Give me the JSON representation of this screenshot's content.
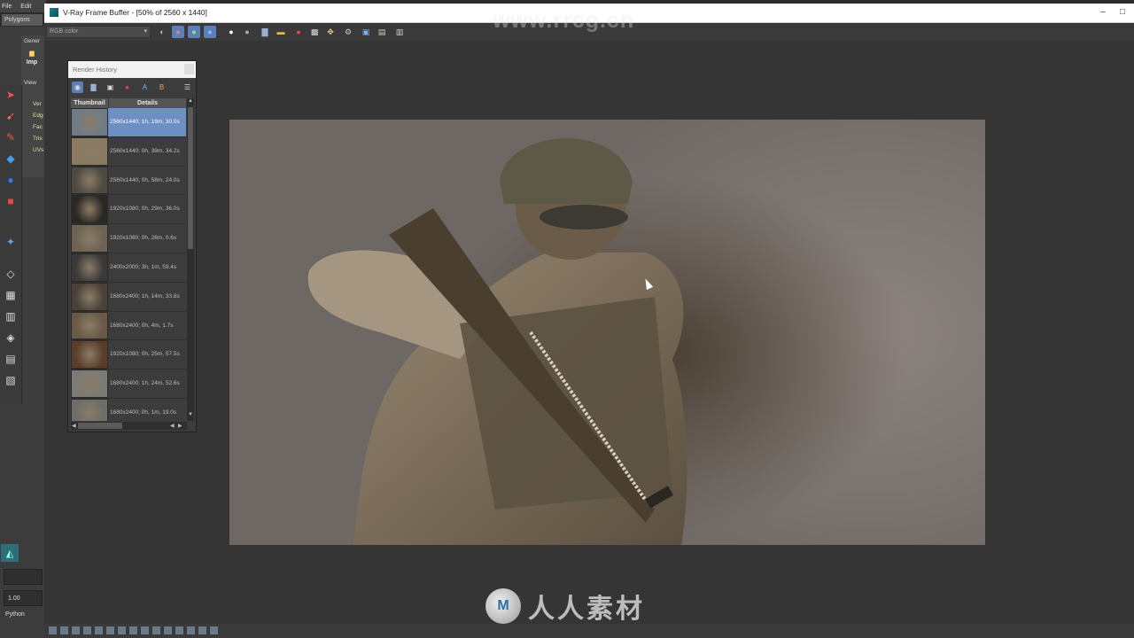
{
  "host": {
    "menu": [
      "File",
      "Edit"
    ],
    "shelf_tab": "Polygons",
    "panel_general": "Gener",
    "panel_import": "Imp",
    "panel_view": "View",
    "components": [
      "Ver",
      "Edg",
      "Fac",
      "Tris",
      "UVs"
    ],
    "field_value": "1.00",
    "console_label": "Python"
  },
  "vfb": {
    "title": "V-Ray Frame Buffer - [50% of 2560 x 1440]",
    "channel": "RGB color",
    "window_buttons": [
      "minimize",
      "maximize"
    ]
  },
  "render_history": {
    "title": "Render History",
    "columns": [
      "Thumbnail",
      "Details"
    ],
    "rows": [
      {
        "detail": "2560x1440; 1h, 19m, 30.0s",
        "selected": true,
        "tone": "#6f7c88"
      },
      {
        "detail": "2560x1440; 0h, 39m, 34.2s",
        "selected": false,
        "tone": "#8a7a62"
      },
      {
        "detail": "2560x1440; 0h, 58m, 24.0s",
        "selected": false,
        "tone": "#4d4a42"
      },
      {
        "detail": "1920x1080; 0h, 29m, 36.0s",
        "selected": false,
        "tone": "#2a2724"
      },
      {
        "detail": "1920x1080; 0h, 26m, 0.6s",
        "selected": false,
        "tone": "#6e6253"
      },
      {
        "detail": "2400x2000; 3h, 1m, 59.4s",
        "selected": false,
        "tone": "#3a3938"
      },
      {
        "detail": "1680x2400; 1h, 14m, 33.8s",
        "selected": false,
        "tone": "#4a4138"
      },
      {
        "detail": "1680x2400; 0h, 4m, 1.7s",
        "selected": false,
        "tone": "#6a5a45"
      },
      {
        "detail": "1920x1080; 0h, 25m, 57.5s",
        "selected": false,
        "tone": "#5a3e2a"
      },
      {
        "detail": "1680x2400; 1h, 24m, 52.6s",
        "selected": false,
        "tone": "#7a7b76"
      },
      {
        "detail": "1680x2400; 0h, 1m, 19.0s",
        "selected": false,
        "tone": "#6d6d69"
      }
    ]
  },
  "watermarks": {
    "top": "www.rrcg.cn",
    "bottom": "人人素材"
  }
}
